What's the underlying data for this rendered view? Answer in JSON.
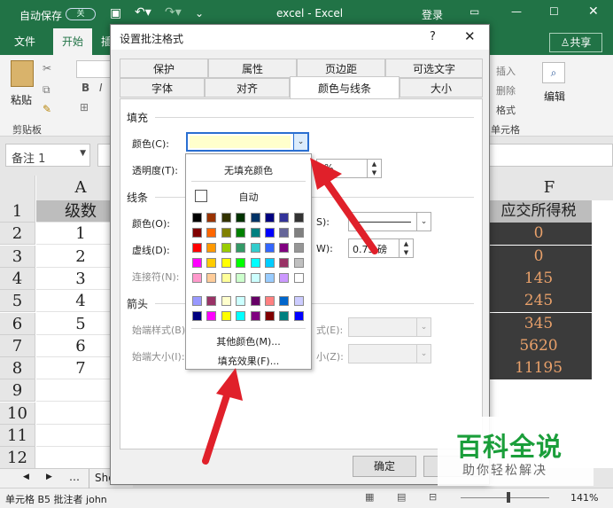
{
  "titlebar": {
    "autosave": "自动保存",
    "toggle": "关",
    "title": "excel  -  Excel",
    "login": "登录"
  },
  "ribbon_tabs": [
    "文件",
    "开始",
    "插"
  ],
  "ribbon_share": "共享",
  "ribbon": {
    "paste": "粘贴",
    "clipboard": "剪贴板",
    "bold": "B",
    "italic": "I",
    "insert": "插入",
    "delete": "删除",
    "format": "格式",
    "cells": "单元格",
    "edit": "编辑"
  },
  "namebox": "备注 1",
  "columns": {
    "A": "A",
    "F": "F"
  },
  "rows": [
    {
      "num": "1",
      "a": "级数",
      "f": "应交所得税"
    },
    {
      "num": "2",
      "a": "1",
      "f": "0"
    },
    {
      "num": "3",
      "a": "2",
      "f": "0"
    },
    {
      "num": "4",
      "a": "3",
      "f": "145"
    },
    {
      "num": "5",
      "a": "4",
      "f": "245"
    },
    {
      "num": "6",
      "a": "5",
      "f": "345"
    },
    {
      "num": "7",
      "a": "6",
      "f": "5620"
    },
    {
      "num": "8",
      "a": "7",
      "f": "11195"
    },
    {
      "num": "9",
      "a": "",
      "f": ""
    },
    {
      "num": "10",
      "a": "",
      "f": ""
    },
    {
      "num": "11",
      "a": "",
      "f": ""
    },
    {
      "num": "12",
      "a": "",
      "f": ""
    }
  ],
  "sheet_tab": "She",
  "status": {
    "left": "单元格 B5 批注者 john",
    "zoom": "141%"
  },
  "dialog": {
    "title": "设置批注格式",
    "help": "?",
    "close": "✕",
    "tabs_row1": [
      "保护",
      "属性",
      "页边距",
      "可选文字"
    ],
    "tabs_row2": [
      "字体",
      "对齐",
      "颜色与线条",
      "大小"
    ],
    "fill_section": "填充",
    "color_label": "颜色(C):",
    "transparency_label": "透明度(T):",
    "transparency_value": "%",
    "line_section": "线条",
    "line_color_label": "颜色(O):",
    "dash_label": "虚线(D):",
    "connector_label": "连接符(N):",
    "line_style_suffix": "S):",
    "weight_suffix": "W):",
    "weight_value": "0.75 磅",
    "arrow_section": "箭头",
    "begin_style": "始端样式(B)",
    "begin_size": "始端大小(I):",
    "end_style_suffix": "式(E):",
    "end_size_suffix": "小(Z):",
    "ok": "确定"
  },
  "palette": {
    "no_fill": "无填充颜色",
    "auto": "自动",
    "more_colors": "其他颜色(M)...",
    "fill_effects": "填充效果(F)...",
    "colors": [
      [
        "#000000",
        "#993300",
        "#333300",
        "#003300",
        "#003366",
        "#000080",
        "#333399",
        "#333333"
      ],
      [
        "#800000",
        "#FF6600",
        "#808000",
        "#008000",
        "#008080",
        "#0000FF",
        "#666699",
        "#808080"
      ],
      [
        "#FF0000",
        "#FF9900",
        "#99CC00",
        "#339966",
        "#33CCCC",
        "#3366FF",
        "#800080",
        "#969696"
      ],
      [
        "#FF00FF",
        "#FFCC00",
        "#FFFF00",
        "#00FF00",
        "#00FFFF",
        "#00CCFF",
        "#993366",
        "#C0C0C0"
      ],
      [
        "#FF99CC",
        "#FFCC99",
        "#FFFF99",
        "#CCFFCC",
        "#CCFFFF",
        "#99CCFF",
        "#CC99FF",
        "#FFFFFF"
      ]
    ],
    "extra_colors": [
      [
        "#9999FF",
        "#993366",
        "#FFFFCC",
        "#CCFFFF",
        "#660066",
        "#FF8080",
        "#0066CC",
        "#CCCCFF"
      ],
      [
        "#000080",
        "#FF00FF",
        "#FFFF00",
        "#00FFFF",
        "#800080",
        "#800000",
        "#008080",
        "#0000FF"
      ]
    ],
    "selected_color": "#FFFFCC"
  },
  "watermark": {
    "main": "百科全说",
    "sub": "助你轻松解决"
  },
  "accent": "#217346",
  "arrow_color": "#e0202a"
}
